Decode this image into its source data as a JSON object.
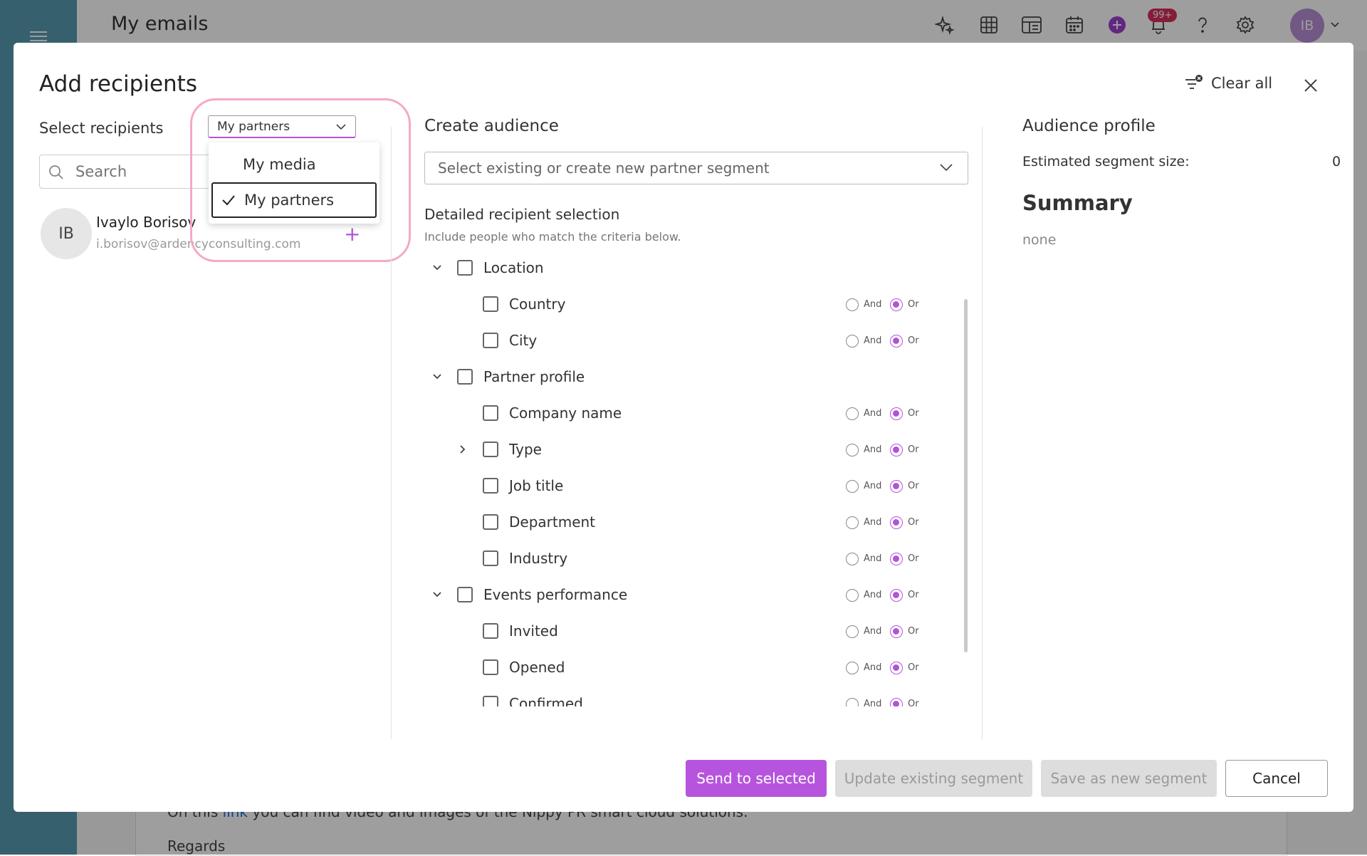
{
  "app": {
    "page_title": "My emails",
    "notifications_badge": "99+",
    "user_initials": "IB"
  },
  "background_editor": {
    "text_before_link": "On this ",
    "link_text": "link",
    "text_after_link": " you can find video and images of the Nippy PR smart cloud solutions.",
    "line2": "Regards"
  },
  "dialog": {
    "title": "Add recipients",
    "clear_all_label": "Clear all",
    "select_recipients_label": "Select recipients",
    "search_placeholder": "Search",
    "source_dropdown": {
      "selected": "My partners",
      "options": [
        {
          "label": "My media",
          "selected": false
        },
        {
          "label": "My partners",
          "selected": true
        }
      ]
    },
    "recipients": [
      {
        "initials": "IB",
        "name": "Ivaylo Borisov",
        "email": "i.borisov@ardencyconsulting.com"
      }
    ]
  },
  "create_audience": {
    "title": "Create audience",
    "segment_placeholder": "Select existing or create new partner segment",
    "detailed_title": "Detailed recipient selection",
    "detailed_subtitle": "Include people who match the criteria below.",
    "and_label": "And",
    "or_label": "Or",
    "criteria": [
      {
        "label": "Location",
        "level": 0,
        "caret": "down",
        "logic": false
      },
      {
        "label": "Country",
        "level": 1,
        "caret": "none",
        "logic": true
      },
      {
        "label": "City",
        "level": 1,
        "caret": "none",
        "logic": true
      },
      {
        "label": "Partner profile",
        "level": 0,
        "caret": "down",
        "logic": false
      },
      {
        "label": "Company name",
        "level": 1,
        "caret": "none",
        "logic": true
      },
      {
        "label": "Type",
        "level": 1,
        "caret": "right",
        "logic": true
      },
      {
        "label": "Job title",
        "level": 1,
        "caret": "none",
        "logic": true
      },
      {
        "label": "Department",
        "level": 1,
        "caret": "none",
        "logic": true
      },
      {
        "label": "Industry",
        "level": 1,
        "caret": "none",
        "logic": true
      },
      {
        "label": "Events performance",
        "level": 0,
        "caret": "down",
        "logic": true
      },
      {
        "label": "Invited",
        "level": 1,
        "caret": "none",
        "logic": true
      },
      {
        "label": "Opened",
        "level": 1,
        "caret": "none",
        "logic": true
      },
      {
        "label": "Confirmed",
        "level": 1,
        "caret": "none",
        "logic": true
      }
    ]
  },
  "audience_profile": {
    "title": "Audience profile",
    "estimated_label": "Estimated segment size:",
    "estimated_value": "0",
    "summary_title": "Summary",
    "summary_value": "none"
  },
  "footer": {
    "send_label": "Send to selected",
    "update_label": "Update existing segment",
    "save_label": "Save as new segment",
    "cancel_label": "Cancel"
  },
  "colors": {
    "accent": "#b654de",
    "sidebar": "#5a9cb3",
    "highlight": "#f4a9c9",
    "badge": "#d9305b"
  }
}
